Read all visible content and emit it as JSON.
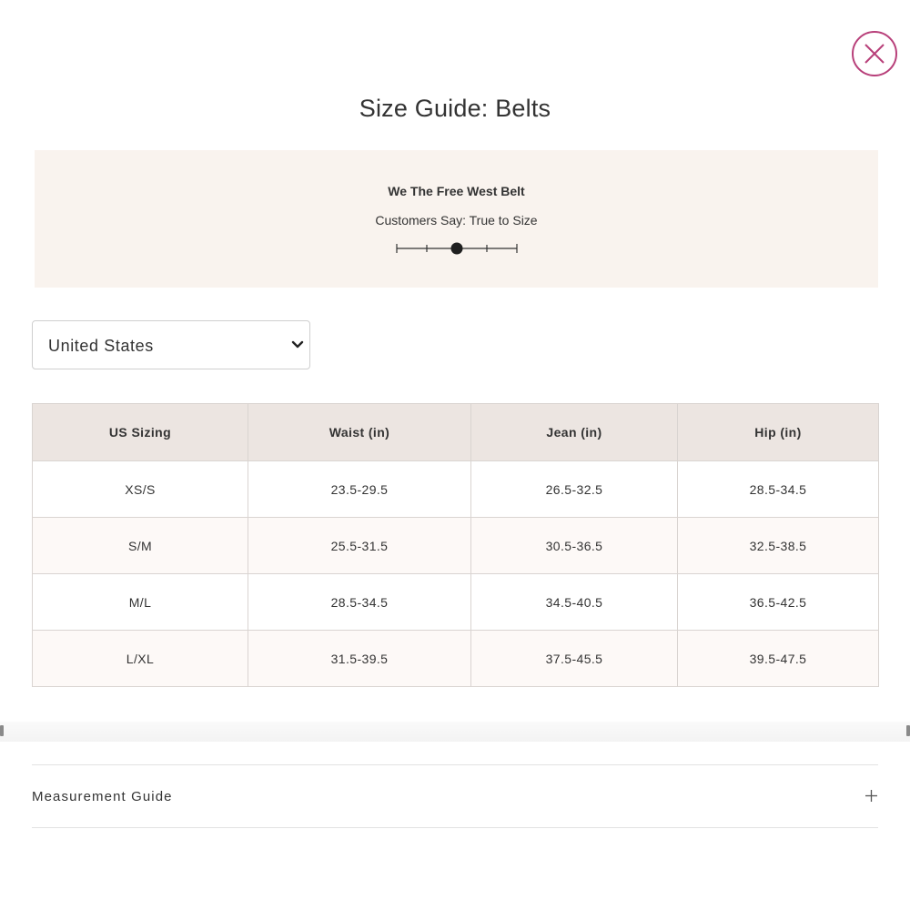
{
  "modal": {
    "title": "Size Guide: Belts",
    "close_icon": "close-icon"
  },
  "fit": {
    "product": "We The Free West Belt",
    "customers_say": "Customers Say: True to Size",
    "scale_level": 0.5,
    "scale_icon": "fit-scale-icon"
  },
  "country_select": {
    "value": "United States",
    "icon": "chevron-down-icon"
  },
  "size_table": {
    "headers": [
      "US Sizing",
      "Waist (in)",
      "Jean (in)",
      "Hip (in)"
    ],
    "rows": [
      [
        "XS/S",
        "23.5-29.5",
        "26.5-32.5",
        "28.5-34.5"
      ],
      [
        "S/M",
        "25.5-31.5",
        "30.5-36.5",
        "32.5-38.5"
      ],
      [
        "M/L",
        "28.5-34.5",
        "34.5-40.5",
        "36.5-42.5"
      ],
      [
        "L/XL",
        "31.5-39.5",
        "37.5-45.5",
        "39.5-47.5"
      ]
    ]
  },
  "accordion": {
    "label": "Measurement Guide",
    "icon": "plus-icon"
  },
  "colors": {
    "accent": "#b8407a",
    "panel_bg": "#f9f3ee",
    "table_header_bg": "#ece5e1",
    "table_alt_row_bg": "#fdf9f7"
  }
}
